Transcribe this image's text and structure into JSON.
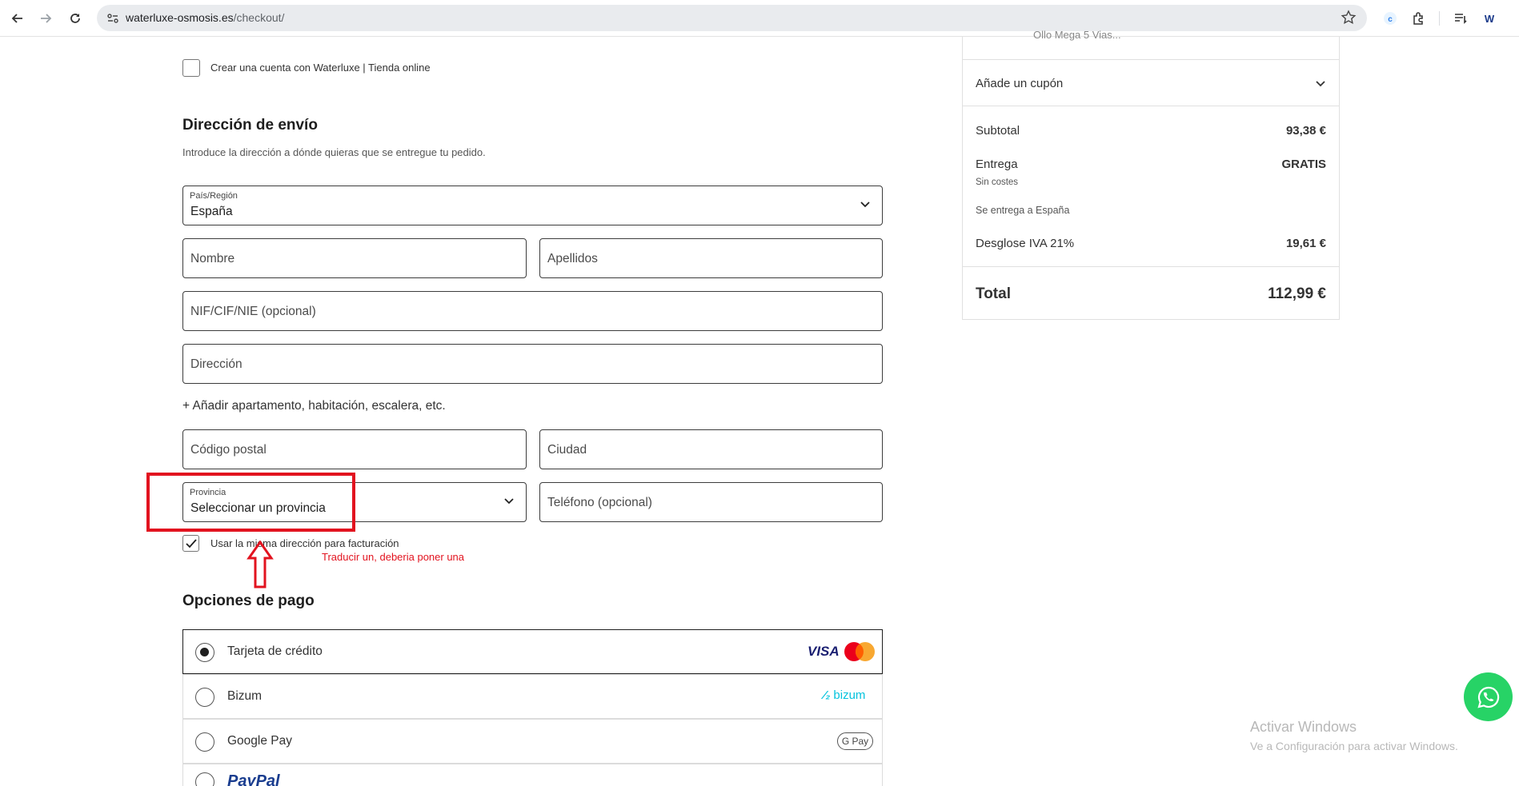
{
  "browser": {
    "url_host": "waterluxe-osmosis.es",
    "url_path": "/checkout/",
    "ext_letter": "W"
  },
  "account": {
    "create_label": "Crear una cuenta con Waterluxe | Tienda online"
  },
  "shipping": {
    "title": "Dirección de envío",
    "description": "Introduce la dirección a dónde quieras que se entregue tu pedido.",
    "country_label": "País/Región",
    "country_value": "España",
    "first_name": "Nombre",
    "last_name": "Apellidos",
    "tax_id": "NIF/CIF/NIE (opcional)",
    "address": "Dirección",
    "add_apartment": "+ Añadir apartamento, habitación, escalera, etc.",
    "postal_code": "Código postal",
    "city": "Ciudad",
    "province_label": "Provincia",
    "province_value": "Seleccionar un provincia",
    "phone": "Teléfono (opcional)",
    "same_billing": "Usar la misma dirección para facturación"
  },
  "annotation": {
    "text": "Traducir un, deberia poner una",
    "color": "#e2131f"
  },
  "payment": {
    "title": "Opciones de pago",
    "options": [
      {
        "label": "Tarjeta de crédito",
        "selected": true
      },
      {
        "label": "Bizum",
        "selected": false
      },
      {
        "label": "Google Pay",
        "selected": false
      },
      {
        "label": "PayPal",
        "selected": false
      }
    ],
    "logos": {
      "visa": "VISA",
      "bizum": "bizum",
      "gpay": "G Pay"
    }
  },
  "summary": {
    "cut_item_text": "Ollo Mega 5 Vias...",
    "coupon": "Añade un cupón",
    "subtotal_label": "Subtotal",
    "subtotal_value": "93,38 €",
    "delivery_label": "Entrega",
    "delivery_value": "GRATIS",
    "delivery_note": "Sin costes",
    "delivery_dest": "Se entrega a España",
    "vat_label": "Desglose IVA 21%",
    "vat_value": "19,61 €",
    "total_label": "Total",
    "total_value": "112,99 €"
  },
  "windows": {
    "line1": "Activar Windows",
    "line2": "Ve a Configuración para activar Windows."
  },
  "colors": {
    "accent_whatsapp": "#27d366",
    "annotation_red": "#e2131f",
    "bizum_teal": "#05c3dd",
    "visa_blue": "#1a1f71"
  }
}
